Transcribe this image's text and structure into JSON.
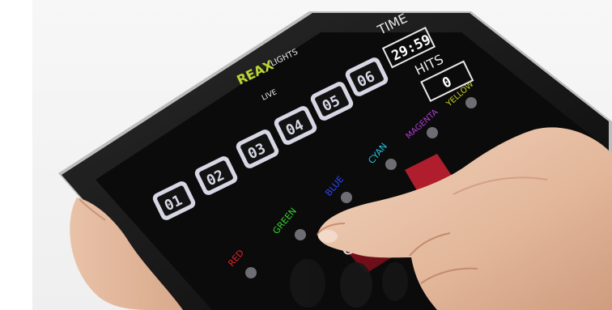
{
  "app": {
    "brand": "REAX",
    "brand_suffix": "LIGHTS",
    "mode": "LIVE"
  },
  "timer": {
    "label": "TIME",
    "value": "29:59"
  },
  "hits": {
    "label": "HITS",
    "value": "0"
  },
  "pads": [
    {
      "label": "01"
    },
    {
      "label": "02"
    },
    {
      "label": "03"
    },
    {
      "label": "04"
    },
    {
      "label": "05"
    },
    {
      "label": "06"
    }
  ],
  "colors": [
    {
      "label": "RED",
      "hex": "#e0242a"
    },
    {
      "label": "GREEN",
      "hex": "#39d12f"
    },
    {
      "label": "BLUE",
      "hex": "#2d47ff"
    },
    {
      "label": "CYAN",
      "hex": "#23c7e6"
    },
    {
      "label": "MAGENTA",
      "hex": "#b23ed8"
    },
    {
      "label": "YELLOW",
      "hex": "#c6cf23"
    }
  ],
  "clear_button": {
    "label": "CLE"
  }
}
